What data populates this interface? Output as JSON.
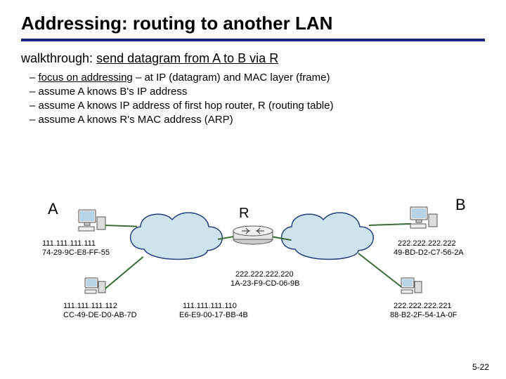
{
  "title": "Addressing: routing to another LAN",
  "subtitle_prefix": "walkthrough: ",
  "subtitle_underlined": "send datagram from A to B via R",
  "bullets": [
    {
      "underlined": "focus on addressing",
      "rest": " – at IP (datagram) and MAC layer (frame)"
    },
    {
      "underlined": "",
      "rest": "assume A knows B's IP address"
    },
    {
      "underlined": "",
      "rest": "assume A knows IP address of first hop router, R (routing table)"
    },
    {
      "underlined": "",
      "rest": "assume A knows R's MAC address (ARP)"
    }
  ],
  "labels": {
    "A": "A",
    "B": "B",
    "R": "R"
  },
  "hosts": {
    "A": {
      "ip": "111.111.111.111",
      "mac": "74-29-9C-E8-FF-55"
    },
    "A2": {
      "ip": "111.111.111.112",
      "mac": "CC-49-DE-D0-AB-7D"
    },
    "R_left": {
      "ip": "111.111.111.110",
      "mac": "E6-E9-00-17-BB-4B"
    },
    "R_right": {
      "ip": "222.222.222.220",
      "mac": "1A-23-F9-CD-06-9B"
    },
    "B": {
      "ip": "222.222.222.222",
      "mac": "49-BD-D2-C7-56-2A"
    },
    "B2": {
      "ip": "222.222.222.221",
      "mac": "88-B2-2F-54-1A-0F"
    }
  },
  "page_number": "5-22"
}
